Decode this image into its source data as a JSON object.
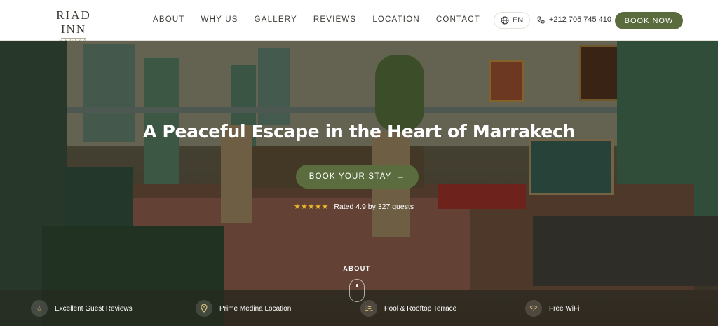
{
  "brand": {
    "name": "RIAD INN",
    "sub": "MEDINA"
  },
  "nav": {
    "items": [
      "ABOUT",
      "WHY US",
      "GALLERY",
      "REVIEWS",
      "LOCATION",
      "CONTACT"
    ]
  },
  "header": {
    "language": "EN",
    "phone": "+212 705 745 410",
    "book_now": "BOOK NOW"
  },
  "hero": {
    "title": "A Peaceful Escape in the Heart of Marrakech",
    "cta": "BOOK YOUR STAY",
    "cta_arrow": "→",
    "stars": "★★★★★",
    "rating_text": "Rated 4.9 by 327 guests",
    "scroll_label": "ABOUT"
  },
  "features": [
    {
      "label": "Excellent Guest Reviews",
      "icon": "star-icon"
    },
    {
      "label": "Prime Medina Location",
      "icon": "location-pin-icon"
    },
    {
      "label": "Pool & Rooftop Terrace",
      "icon": "waves-icon"
    },
    {
      "label": "Free WiFi",
      "icon": "wifi-icon"
    }
  ],
  "colors": {
    "accent": "#5a6b3e",
    "star": "#e8b52a"
  }
}
